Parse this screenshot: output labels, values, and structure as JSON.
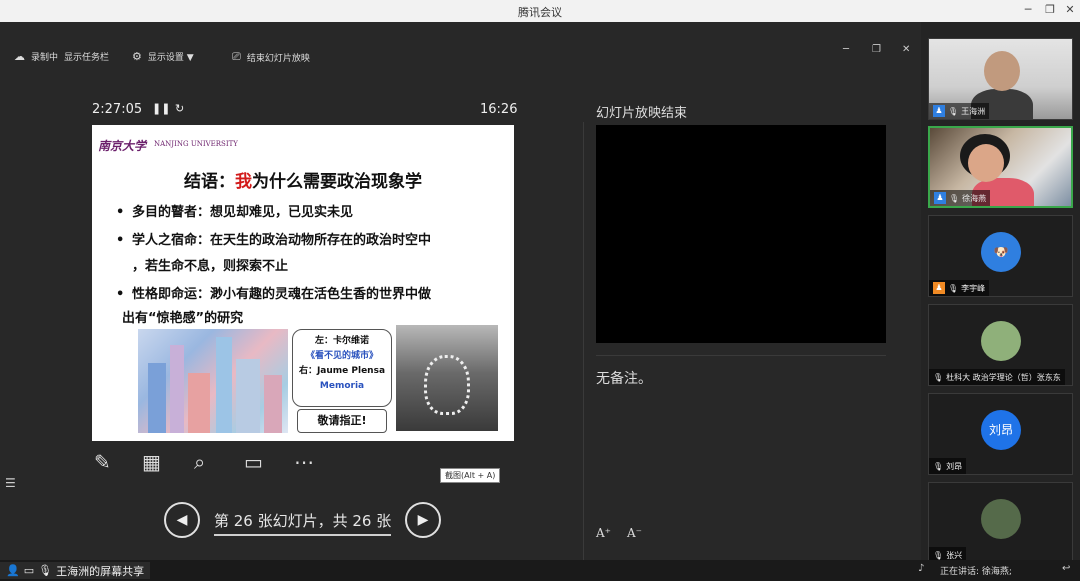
{
  "window": {
    "title": "腾讯会议"
  },
  "toolbar": {
    "recording": "录制中",
    "taskbar": "显示任务栏",
    "display_settings": "显示设置 ▼",
    "end_slideshow": "结束幻灯片放映"
  },
  "presenter": {
    "timer": "2:27:05",
    "clock": "16:26",
    "slide": {
      "logo_cn": "南京大学",
      "logo_en": "NANJING UNIVERSITY",
      "title_prefix": "结语：",
      "title_red": "我",
      "title_rest": "为什么需要政治现象学",
      "bullets": [
        "多目的瞽者：想见却难见，已见实未见",
        "学人之宿命：在天生的政治动物所存在的政治时空中",
        "，若生命不息，则探索不止",
        "性格即命运：渺小有趣的灵魂在活色生香的世界中做",
        "出有“惊艳感”的研究"
      ],
      "caption_left": "左：卡尔维诺",
      "caption_book": "《看不见的城市》",
      "caption_right": "右：Jaume Plensa",
      "caption_work": "Memoria",
      "thanks": "敬请指正!"
    },
    "tooltip": "截图(Alt + A)",
    "slide_counter": "第 26 张幻灯片，共 26 张",
    "ended_label": "幻灯片放映结束",
    "notes": "无备注。"
  },
  "participants": [
    {
      "name": "王海洲",
      "type": "video"
    },
    {
      "name": "徐海燕",
      "type": "video"
    },
    {
      "name": "李宇峰",
      "type": "avatar",
      "avatar_color": "#2f7fe0"
    },
    {
      "name": "杜科大 政治学理论（哲）张东东",
      "type": "avatar",
      "avatar_color": "#8fb07a"
    },
    {
      "name": "刘昂",
      "type": "avatar",
      "avatar_text": "刘昂",
      "avatar_color": "#1f73e8"
    },
    {
      "name": "张兴",
      "type": "avatar",
      "avatar_color": "#556a4a"
    }
  ],
  "statusbar": {
    "sharing": "王海洲的屏幕共享",
    "speaking": "正在讲话: 徐海燕;"
  }
}
